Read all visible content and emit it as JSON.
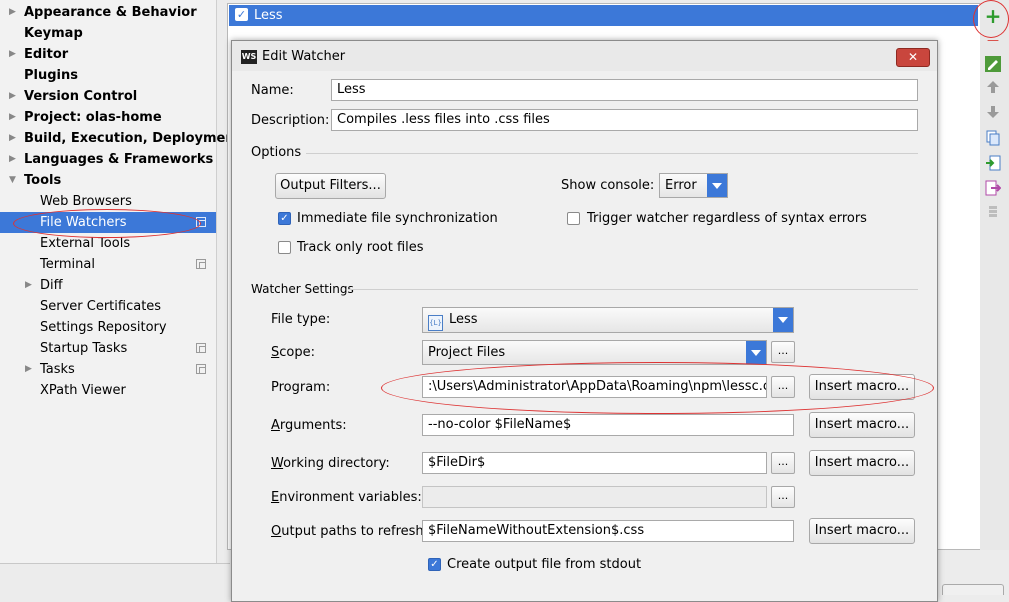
{
  "tree": {
    "items": [
      {
        "label": "Appearance & Behavior",
        "level": 0,
        "expandable": true
      },
      {
        "label": "Keymap",
        "level": 0,
        "expandable": false
      },
      {
        "label": "Editor",
        "level": 0,
        "expandable": true
      },
      {
        "label": "Plugins",
        "level": 0,
        "expandable": false
      },
      {
        "label": "Version Control",
        "level": 0,
        "expandable": true
      },
      {
        "label": "Project: olas-home",
        "level": 0,
        "expandable": true
      },
      {
        "label": "Build, Execution, Deployment",
        "level": 0,
        "expandable": true
      },
      {
        "label": "Languages & Frameworks",
        "level": 0,
        "expandable": true
      },
      {
        "label": "Tools",
        "level": 0,
        "expandable": true,
        "expanded": true
      },
      {
        "label": "Web Browsers",
        "level": 1
      },
      {
        "label": "File Watchers",
        "level": 1,
        "selected": true
      },
      {
        "label": "External Tools",
        "level": 1
      },
      {
        "label": "Terminal",
        "level": 1
      },
      {
        "label": "Diff",
        "level": 1,
        "expandable": true
      },
      {
        "label": "Server Certificates",
        "level": 1
      },
      {
        "label": "Settings Repository",
        "level": 1
      },
      {
        "label": "Startup Tasks",
        "level": 1
      },
      {
        "label": "Tasks",
        "level": 1,
        "expandable": true
      },
      {
        "label": "XPath Viewer",
        "level": 1
      }
    ]
  },
  "watchers": {
    "row_label": "Less",
    "checkmark": "✓"
  },
  "toolbar": {
    "add_glyph": "+",
    "remove_glyph": "—"
  },
  "dialog": {
    "icon_text": "WS",
    "title": "Edit Watcher",
    "close_glyph": "✕",
    "name_label": "Name:",
    "name_value": "Less",
    "description_label": "Description:",
    "description_value": "Compiles .less files into .css files",
    "options_header": "Options",
    "output_filters_button": "Output Filters...",
    "show_console_label": "Show console:",
    "show_console_value": "Error",
    "immediate_sync_label": "Immediate file synchronization",
    "trigger_regardless_label": "Trigger watcher regardless of syntax errors",
    "track_root_label": "Track only root files",
    "watcher_settings_header": "Watcher Settings",
    "file_type_label": "File type:",
    "file_type_value": "Less",
    "file_type_icon_text": "{L}",
    "scope_label": "Scope:",
    "scope_value": "Project Files",
    "program_label": "Program:",
    "program_value": ":\\Users\\Administrator\\AppData\\Roaming\\npm\\lessc.cmd",
    "arguments_label": "Arguments:",
    "arguments_value": "--no-color $FileName$",
    "working_dir_label": "Working directory:",
    "working_dir_value": "$FileDir$",
    "env_vars_label": "Environment variables:",
    "env_vars_value": "",
    "output_paths_label": "Output paths to refresh:",
    "output_paths_value": "$FileNameWithoutExtension$.css",
    "create_output_label": "Create output file from stdout",
    "insert_macro_label": "Insert macro...",
    "browse_label": "...",
    "checks": {
      "immediate_sync": true,
      "trigger_regardless": false,
      "track_root": false,
      "create_output": true
    }
  },
  "colors": {
    "selection": "#3c78d8",
    "annotation": "#dd3333",
    "add_icon": "#2e9b2e",
    "remove_icon": "#d9413a"
  }
}
